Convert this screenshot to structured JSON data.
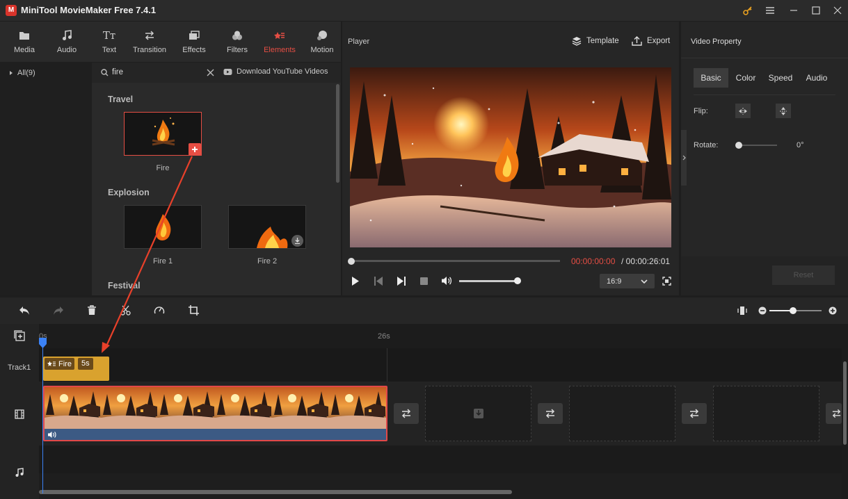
{
  "app": {
    "title": "MiniTool MovieMaker Free 7.4.1",
    "logo_letter": "M"
  },
  "toolbar": {
    "items": [
      {
        "label": "Media",
        "icon": "folder-icon"
      },
      {
        "label": "Audio",
        "icon": "music-note-icon"
      },
      {
        "label": "Text",
        "icon": "text-icon"
      },
      {
        "label": "Transition",
        "icon": "transition-icon"
      },
      {
        "label": "Effects",
        "icon": "effects-icon"
      },
      {
        "label": "Filters",
        "icon": "filters-icon"
      },
      {
        "label": "Elements",
        "icon": "elements-icon",
        "active": true
      },
      {
        "label": "Motion",
        "icon": "motion-icon"
      }
    ]
  },
  "categories": {
    "all_label": "All(9)"
  },
  "search": {
    "value": "fire",
    "download_label": "Download YouTube Videos"
  },
  "library": {
    "sections": [
      {
        "title": "Travel",
        "items": [
          {
            "label": "Fire"
          }
        ]
      },
      {
        "title": "Explosion",
        "items": [
          {
            "label": "Fire 1"
          },
          {
            "label": "Fire 2"
          }
        ]
      },
      {
        "title": "Festival",
        "items": []
      }
    ]
  },
  "player": {
    "title": "Player",
    "template_label": "Template",
    "export_label": "Export",
    "current_time": "00:00:00:00",
    "total_time": "/ 00:00:26:01",
    "aspect_ratio": "16:9",
    "progress": 0,
    "volume": 0.95
  },
  "property": {
    "title": "Video Property",
    "tabs": [
      "Basic",
      "Color",
      "Speed",
      "Audio"
    ],
    "active_tab": "Basic",
    "flip_label": "Flip:",
    "rotate_label": "Rotate:",
    "rotate_value": "0°",
    "reset_label": "Reset"
  },
  "timeline": {
    "ruler": {
      "start": "0s",
      "mark": "26s"
    },
    "track1_label": "Track1",
    "element_clip": {
      "name": "Fire",
      "duration": "5s"
    },
    "zoom_level": 0.45
  },
  "colors": {
    "accent": "#e64e44",
    "clip_gold": "#d9a22e",
    "video_border": "#e24848",
    "audio_bar": "#3c5a84"
  }
}
